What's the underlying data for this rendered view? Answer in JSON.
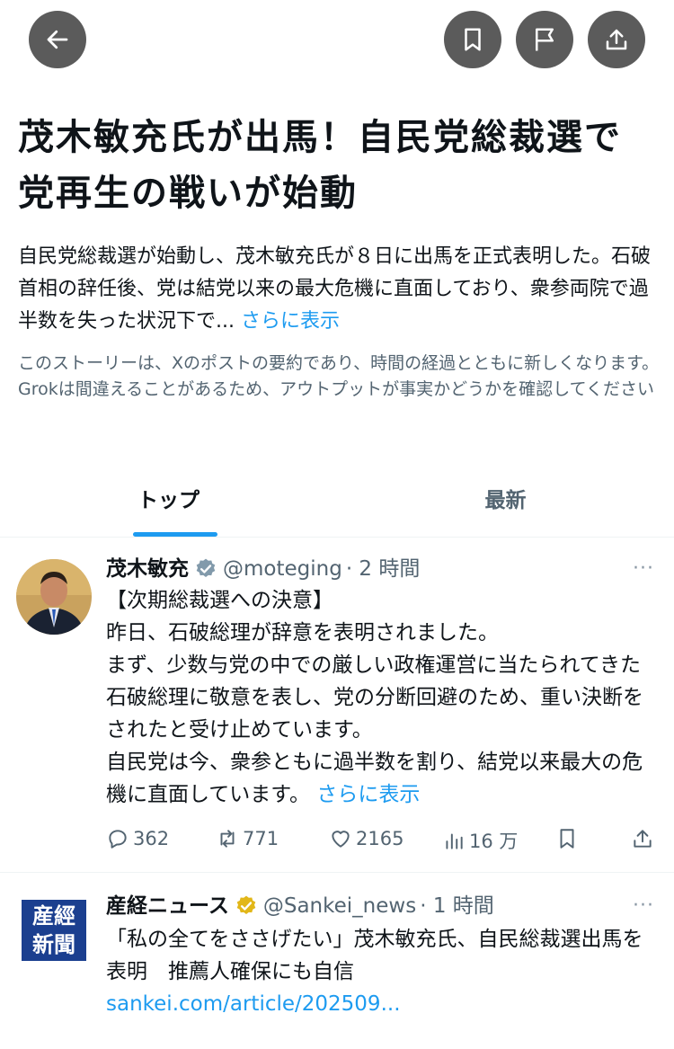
{
  "header": {
    "back_icon": "arrow-left-icon",
    "bookmark_icon": "bookmark-icon",
    "report_icon": "flag-icon",
    "share_icon": "share-icon"
  },
  "story": {
    "headline": "茂木敏充氏が出馬！自民党総裁選で党再生の戦いが始動",
    "summary": "自民党総裁選が始動し、茂木敏充氏が８日に出馬を正式表明した。石破首相の辞任後、党は結党以来の最大危機に直面しており、衆参両院で過半数を失った状況下で...",
    "summary_more": "さらに表示",
    "disclaimer": "このストーリーは、Xのポストの要約であり、時間の経過とともに新しくなります。Grokは間違えることがあるため、アウトプットが事実かどうかを確認してください"
  },
  "tabs": [
    {
      "label": "トップ",
      "active": true
    },
    {
      "label": "最新",
      "active": false
    }
  ],
  "posts": [
    {
      "name": "茂木敏充",
      "handle": "@moteging",
      "time": "· 2 時間",
      "verified_color": "#829aab",
      "body": "【次期総裁選への決意】\n昨日、石破総理が辞意を表明されました。\nまず、少数与党の中での厳しい政権運営に当たられてきた石破総理に敬意を表し、党の分断回避のため、重い決断をされたと受け止めています。\n自民党は今、衆参ともに過半数を割り、結党以来最大の危機に直面しています。",
      "more": "さらに表示",
      "metrics": {
        "replies": "362",
        "reposts": "771",
        "likes": "2165",
        "views": "16 万"
      }
    },
    {
      "name": "産経ニュース",
      "handle": "@Sankei_news",
      "time": "· 1 時間",
      "verified_color": "#e2b719",
      "body": "「私の全てをささげたい」茂木敏充氏、自民総裁選出馬を表明　推薦人確保にも自信",
      "link": "sankei.com/article/202509...",
      "logo_text": "産經新聞"
    }
  ],
  "more_icon": "···",
  "colors": {
    "accent": "#1d9bf0",
    "muted": "#536471",
    "button_bg": "#5b5b5b",
    "sankei_logo_bg": "#1b3f8f"
  }
}
